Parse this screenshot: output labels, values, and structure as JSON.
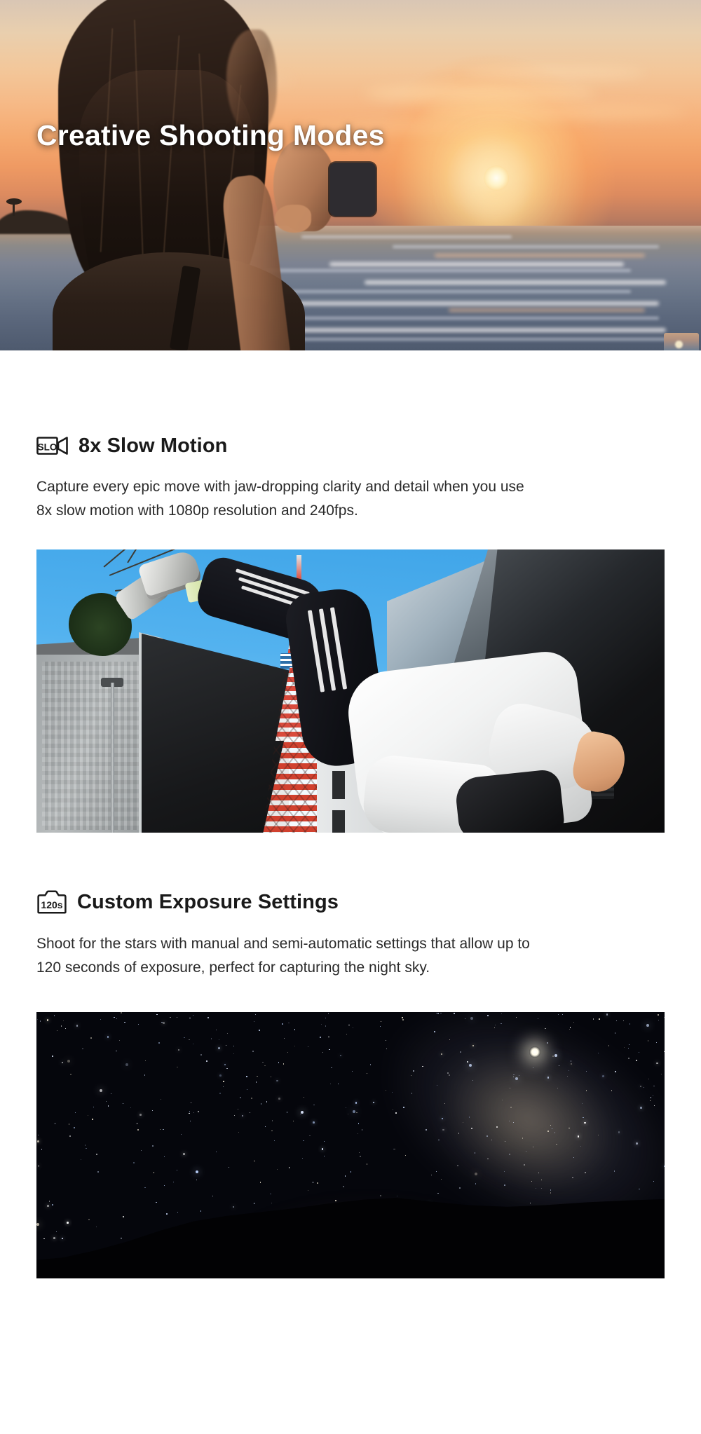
{
  "hero": {
    "title": "Creative Shooting Modes",
    "image_alt": "Woman silhouetted at the beach holding a small action camera up toward an orange sunset over the ocean",
    "scene": {
      "subject": "woman-with-action-camera",
      "setting": "beach-sunset",
      "sun_label": "sun",
      "ocean_label": "ocean"
    }
  },
  "sections": [
    {
      "id": "slow-motion",
      "icon": {
        "name": "slow-motion-video-icon",
        "label": "SLO",
        "shape": "video-camera"
      },
      "title": "8x Slow Motion",
      "body": "Capture every epic move with jaw-dropping clarity and detail when you use 8x slow motion with 1080p resolution and 240fps.",
      "image_alt": "Parkour athlete mid-flip in a Tokyo street with Tokyo Tower rising against a clear blue sky",
      "specs": {
        "speed": "8x",
        "resolution": "1080p",
        "framerate": "240fps"
      }
    },
    {
      "id": "custom-exposure",
      "icon": {
        "name": "long-exposure-camera-icon",
        "label": "120s",
        "shape": "camera-body"
      },
      "title": "Custom Exposure Settings",
      "body": "Shoot for the stars with manual and semi-automatic settings that allow up to 120 seconds of exposure, perfect for capturing the night sky.",
      "image_alt": "Long-exposure night sky photograph showing the Milky Way, a bright planet and an orange glow above a dark mountain ridge",
      "specs": {
        "max_exposure": "120 seconds",
        "modes": "manual and semi-automatic"
      }
    }
  ],
  "colors": {
    "page_background": "#ffffff",
    "heading_text": "#1a1a1a",
    "body_text": "#2a2a2a",
    "hero_title_text": "#ffffff",
    "icon_stroke": "#1a1a1a",
    "sunset_orange": "#f5a96f",
    "tokyo_tower_red": "#d94a3c",
    "night_glow_orange": "#ffb034"
  }
}
